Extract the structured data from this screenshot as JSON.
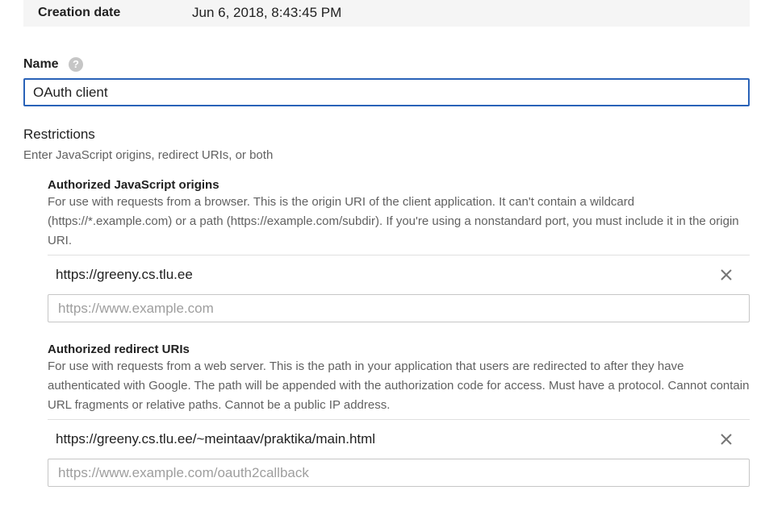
{
  "creation": {
    "label": "Creation date",
    "value": "Jun 6, 2018, 8:43:45 PM"
  },
  "name_field": {
    "label": "Name",
    "help_icon": "help-icon",
    "value": "OAuth client"
  },
  "restrictions": {
    "title": "Restrictions",
    "description": "Enter JavaScript origins, redirect URIs, or both"
  },
  "js_origins": {
    "title": "Authorized JavaScript origins",
    "description": "For use with requests from a browser. This is the origin URI of the client application. It can't contain a wildcard (https://*.example.com) or a path (https://example.com/subdir). If you're using a nonstandard port, you must include it in the origin URI.",
    "entries": [
      "https://greeny.cs.tlu.ee"
    ],
    "placeholder": "https://www.example.com"
  },
  "redirect_uris": {
    "title": "Authorized redirect URIs",
    "description": "For use with requests from a web server. This is the path in your application that users are redirected to after they have authenticated with Google. The path will be appended with the authorization code for access. Must have a protocol. Cannot contain URL fragments or relative paths. Cannot be a public IP address.",
    "entries": [
      "https://greeny.cs.tlu.ee/~meintaav/praktika/main.html"
    ],
    "placeholder": "https://www.example.com/oauth2callback"
  },
  "colors": {
    "focus_border": "#2962b8",
    "secondary_text": "#616161",
    "band_background": "#f5f5f5"
  }
}
